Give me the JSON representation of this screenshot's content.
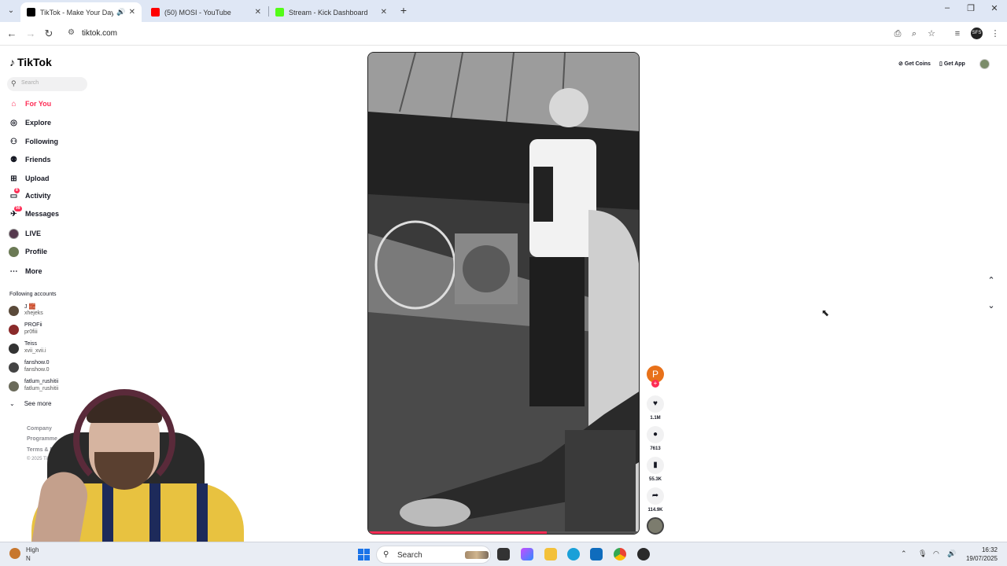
{
  "browser": {
    "tabs": [
      {
        "title": "TikTok - Make Your Day"
      },
      {
        "title": "(50) MOSI - YouTube"
      },
      {
        "title": "Stream - Kick Dashboard"
      }
    ],
    "url": "tiktok.com",
    "profile_initials": "SFS"
  },
  "colors": {
    "accent": "#fe2c55",
    "youtube": "#ff0000",
    "kick": "#53fc18"
  },
  "sidebar": {
    "logo": "TikTok",
    "search_placeholder": "Search",
    "nav": [
      {
        "label": "For You",
        "icon": "home-icon"
      },
      {
        "label": "Explore",
        "icon": "compass-icon"
      },
      {
        "label": "Following",
        "icon": "user-follow-icon"
      },
      {
        "label": "Friends",
        "icon": "friends-icon"
      },
      {
        "label": "Upload",
        "icon": "upload-icon"
      },
      {
        "label": "Activity",
        "icon": "activity-icon",
        "badge": "8"
      },
      {
        "label": "Messages",
        "icon": "messages-icon",
        "badge": "99"
      },
      {
        "label": "LIVE",
        "icon": "live-icon"
      },
      {
        "label": "Profile",
        "icon": "profile-icon"
      },
      {
        "label": "More",
        "icon": "more-icon"
      }
    ],
    "following_title": "Following accounts",
    "accounts": [
      {
        "name": "J 🧱",
        "handle": "xhejeks"
      },
      {
        "name": "PROFii",
        "handle": "pr0fiii"
      },
      {
        "name": "Teiss",
        "handle": "xvii_xvii.i"
      },
      {
        "name": "fanshow.0",
        "handle": "fanshow.0"
      },
      {
        "name": "fatlum_rushitii",
        "handle": "fatlum_rushitii"
      }
    ],
    "see_more": "See more",
    "footer": [
      "Company",
      "Programme",
      "Terms & Policies"
    ],
    "copyright": "© 2025 TikTok"
  },
  "topright": {
    "coins": "Get Coins",
    "app": "Get App"
  },
  "video": {
    "creator_initial": "P",
    "likes": "1.1M",
    "comments": "7613",
    "saves": "55.3K",
    "shares": "114.9K",
    "progress": 0.66
  },
  "taskbar": {
    "search": "Search",
    "time": "16:32",
    "date": "19/07/2025",
    "notification_line1": "High",
    "notification_line2": "N"
  }
}
